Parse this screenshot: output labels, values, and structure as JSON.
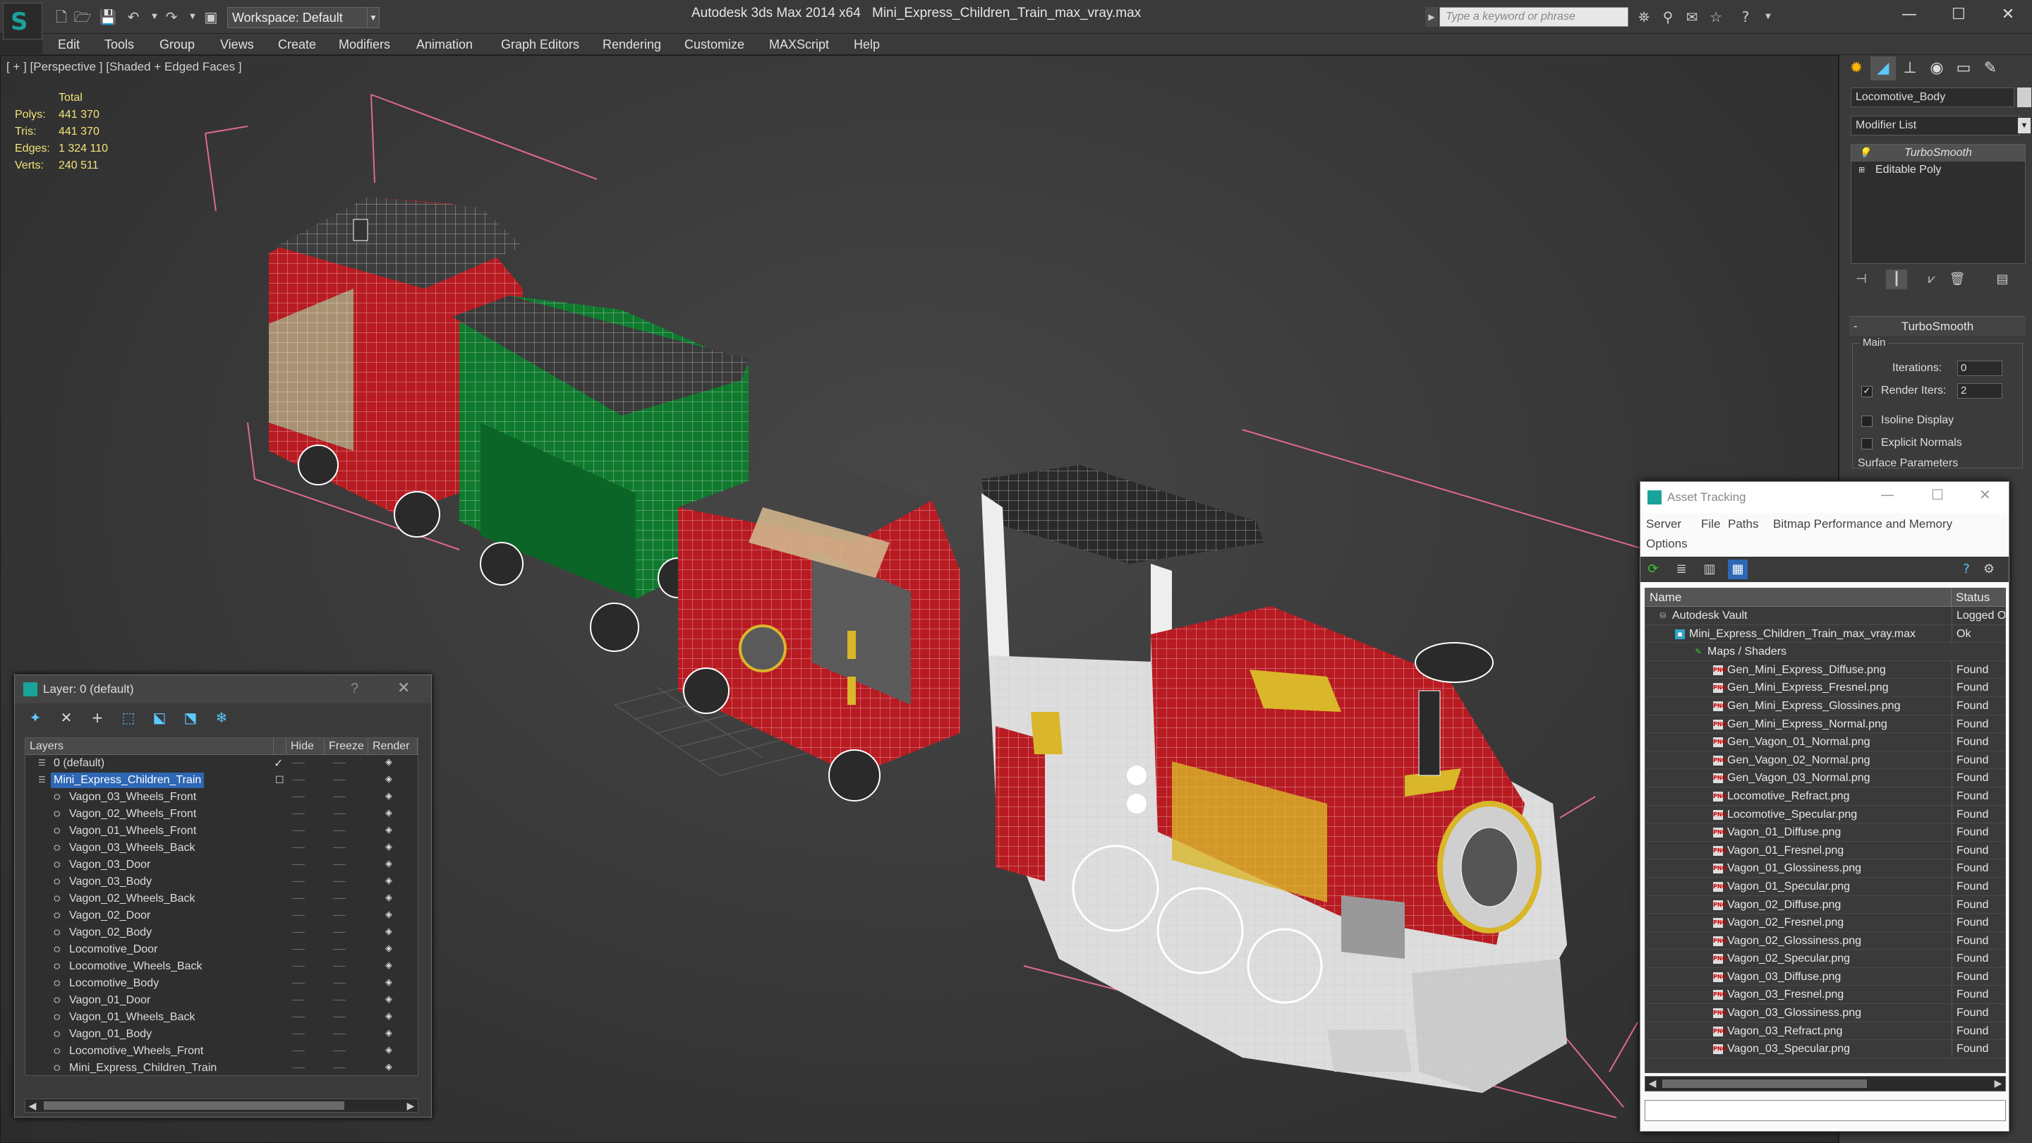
{
  "titlebar": {
    "app_title": "Autodesk 3ds Max  2014 x64",
    "file_title": "Mini_Express_Children_Train_max_vray.max",
    "workspace_label": "Workspace: Default",
    "search_placeholder": "Type a keyword or phrase",
    "window_buttons": [
      "—",
      "☐",
      "✕"
    ]
  },
  "menu": [
    "Edit",
    "Tools",
    "Group",
    "Views",
    "Create",
    "Modifiers",
    "Animation",
    "Graph Editors",
    "Rendering",
    "Customize",
    "MAXScript",
    "Help"
  ],
  "viewport": {
    "label": "[ + ] [Perspective ] [Shaded + Edged Faces ]",
    "stats_header": "Total",
    "stats": [
      {
        "key": "Polys:",
        "value": "441 370"
      },
      {
        "key": "Tris:",
        "value": "441 370"
      },
      {
        "key": "Edges:",
        "value": "1 324 110"
      },
      {
        "key": "Verts:",
        "value": "240 511"
      }
    ]
  },
  "command_panel": {
    "object_name": "Locomotive_Body",
    "modifier_list": "Modifier List",
    "stack": [
      "TurboSmooth",
      "Editable Poly"
    ],
    "rollout_title": "TurboSmooth",
    "group_main": "Main",
    "iterations_label": "Iterations:",
    "iterations_value": "0",
    "render_iters_label": "Render Iters:",
    "render_iters_value": "2",
    "render_iters_checked": true,
    "isoline_label": "Isoline Display",
    "explicit_label": "Explicit Normals",
    "surface_label": "Surface Parameters"
  },
  "layer_dialog": {
    "title": "Layer: 0 (default)",
    "help": "?",
    "columns": [
      "Layers",
      "Hide",
      "Freeze",
      "Render"
    ],
    "rows": [
      {
        "name": "0 (default)",
        "level": 0,
        "current": true
      },
      {
        "name": "Mini_Express_Children_Train",
        "level": 0,
        "selected": true
      },
      {
        "name": "Vagon_03_Wheels_Front",
        "level": 1
      },
      {
        "name": "Vagon_02_Wheels_Front",
        "level": 1
      },
      {
        "name": "Vagon_01_Wheels_Front",
        "level": 1
      },
      {
        "name": "Vagon_03_Wheels_Back",
        "level": 1
      },
      {
        "name": "Vagon_03_Door",
        "level": 1
      },
      {
        "name": "Vagon_03_Body",
        "level": 1
      },
      {
        "name": "Vagon_02_Wheels_Back",
        "level": 1
      },
      {
        "name": "Vagon_02_Door",
        "level": 1
      },
      {
        "name": "Vagon_02_Body",
        "level": 1
      },
      {
        "name": "Locomotive_Door",
        "level": 1
      },
      {
        "name": "Locomotive_Wheels_Back",
        "level": 1
      },
      {
        "name": "Locomotive_Body",
        "level": 1
      },
      {
        "name": "Vagon_01_Door",
        "level": 1
      },
      {
        "name": "Vagon_01_Wheels_Back",
        "level": 1
      },
      {
        "name": "Vagon_01_Body",
        "level": 1
      },
      {
        "name": "Locomotive_Wheels_Front",
        "level": 1
      },
      {
        "name": "Mini_Express_Children_Train",
        "level": 1
      }
    ]
  },
  "asset_tracking": {
    "title": "Asset Tracking",
    "menu": [
      "Server",
      "File",
      "Paths",
      "Bitmap Performance and Memory",
      "Options"
    ],
    "columns": [
      "Name",
      "Status"
    ],
    "rows": [
      {
        "name": "Autodesk Vault",
        "status": "Logged O",
        "icon": "vault",
        "level": 0
      },
      {
        "name": "Mini_Express_Children_Train_max_vray.max",
        "status": "Ok",
        "icon": "max",
        "level": 1
      },
      {
        "name": "Maps / Shaders",
        "status": "",
        "icon": "maps",
        "level": 2
      },
      {
        "name": "Gen_Mini_Express_Diffuse.png",
        "status": "Found",
        "icon": "png",
        "level": 3
      },
      {
        "name": "Gen_Mini_Express_Fresnel.png",
        "status": "Found",
        "icon": "png",
        "level": 3
      },
      {
        "name": "Gen_Mini_Express_Glossines.png",
        "status": "Found",
        "icon": "png",
        "level": 3
      },
      {
        "name": "Gen_Mini_Express_Normal.png",
        "status": "Found",
        "icon": "png",
        "level": 3
      },
      {
        "name": "Gen_Vagon_01_Normal.png",
        "status": "Found",
        "icon": "png",
        "level": 3
      },
      {
        "name": "Gen_Vagon_02_Normal.png",
        "status": "Found",
        "icon": "png",
        "level": 3
      },
      {
        "name": "Gen_Vagon_03_Normal.png",
        "status": "Found",
        "icon": "png",
        "level": 3
      },
      {
        "name": "Locomotive_Refract.png",
        "status": "Found",
        "icon": "png",
        "level": 3
      },
      {
        "name": "Locomotive_Specular.png",
        "status": "Found",
        "icon": "png",
        "level": 3
      },
      {
        "name": "Vagon_01_Diffuse.png",
        "status": "Found",
        "icon": "png",
        "level": 3
      },
      {
        "name": "Vagon_01_Fresnel.png",
        "status": "Found",
        "icon": "png",
        "level": 3
      },
      {
        "name": "Vagon_01_Glossiness.png",
        "status": "Found",
        "icon": "png",
        "level": 3
      },
      {
        "name": "Vagon_01_Specular.png",
        "status": "Found",
        "icon": "png",
        "level": 3
      },
      {
        "name": "Vagon_02_Diffuse.png",
        "status": "Found",
        "icon": "png",
        "level": 3
      },
      {
        "name": "Vagon_02_Fresnel.png",
        "status": "Found",
        "icon": "png",
        "level": 3
      },
      {
        "name": "Vagon_02_Glossiness.png",
        "status": "Found",
        "icon": "png",
        "level": 3
      },
      {
        "name": "Vagon_02_Specular.png",
        "status": "Found",
        "icon": "png",
        "level": 3
      },
      {
        "name": "Vagon_03_Diffuse.png",
        "status": "Found",
        "icon": "png",
        "level": 3
      },
      {
        "name": "Vagon_03_Fresnel.png",
        "status": "Found",
        "icon": "png",
        "level": 3
      },
      {
        "name": "Vagon_03_Glossiness.png",
        "status": "Found",
        "icon": "png",
        "level": 3
      },
      {
        "name": "Vagon_03_Refract.png",
        "status": "Found",
        "icon": "png",
        "level": 3
      },
      {
        "name": "Vagon_03_Specular.png",
        "status": "Found",
        "icon": "png",
        "level": 3
      }
    ]
  },
  "colors": {
    "selection": "#2d67b5",
    "accent": "#1aa39a",
    "stats_text": "#f3e27a",
    "train_red": "#c0141c",
    "train_green": "#0f7a2e",
    "train_gold": "#d9b62a"
  }
}
